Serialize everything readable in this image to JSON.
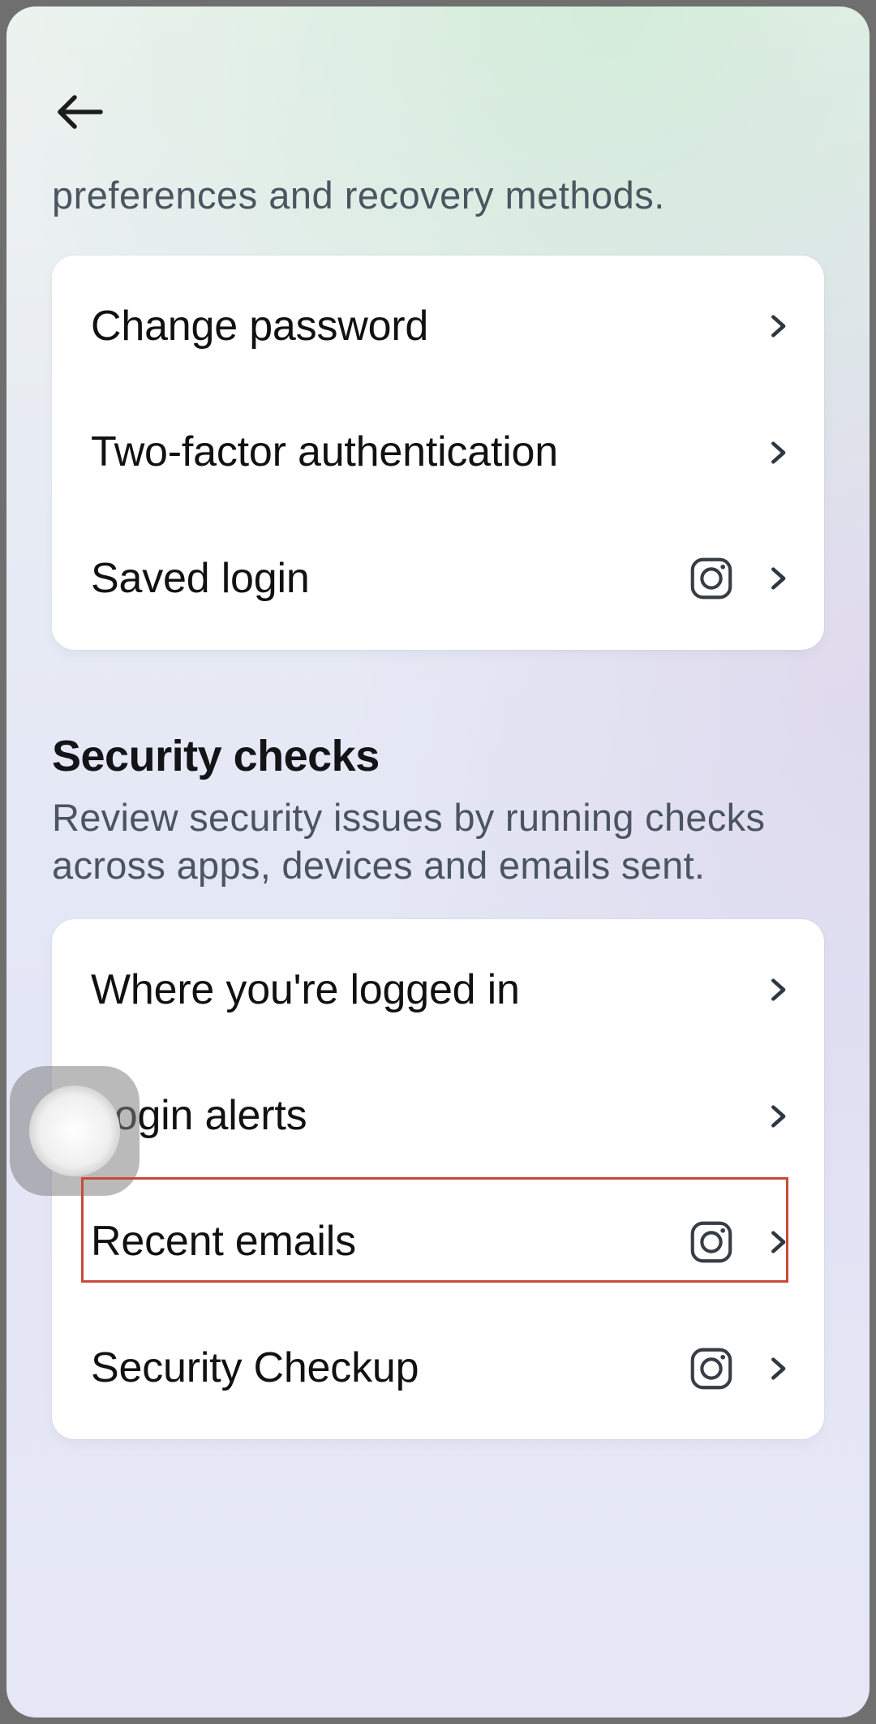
{
  "header": {
    "subtitle_top": "preferences and recovery methods."
  },
  "login_security": {
    "rows": [
      {
        "label": "Change password",
        "hasInstagram": false
      },
      {
        "label": "Two-factor authentication",
        "hasInstagram": false
      },
      {
        "label": "Saved login",
        "hasInstagram": true
      }
    ]
  },
  "security_checks": {
    "title": "Security checks",
    "subtitle": "Review security issues by running checks across apps, devices and emails sent.",
    "rows": [
      {
        "label": "Where you're logged in",
        "hasInstagram": false
      },
      {
        "label": "Login alerts",
        "hasInstagram": false
      },
      {
        "label": "Recent emails",
        "hasInstagram": true
      },
      {
        "label": "Security Checkup",
        "hasInstagram": true
      }
    ]
  },
  "highlighted_row_index": 0
}
